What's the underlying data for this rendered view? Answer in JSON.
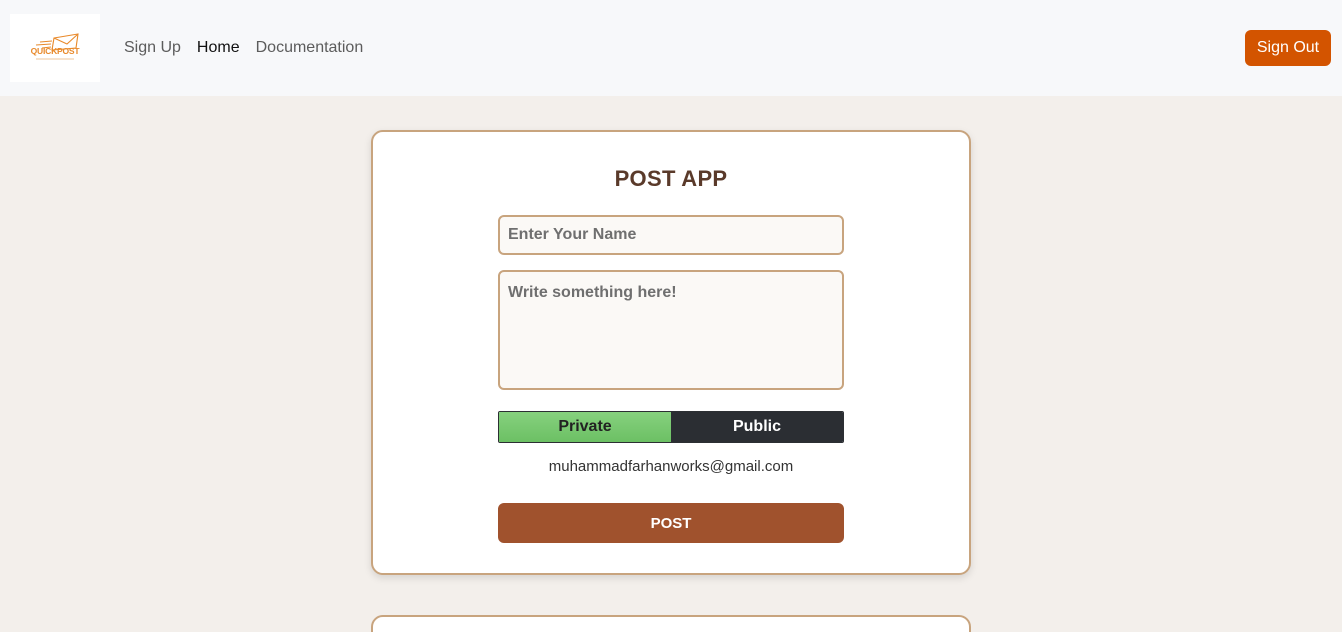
{
  "nav": {
    "logo_text": "QUICKPOST",
    "links": [
      {
        "label": "Sign Up"
      },
      {
        "label": "Home"
      },
      {
        "label": "Documentation"
      }
    ],
    "signout_label": "Sign Out"
  },
  "card": {
    "title": "POST APP",
    "name_placeholder": "Enter Your Name",
    "message_placeholder": "Write something here!",
    "visibility": {
      "private_label": "Private",
      "public_label": "Public"
    },
    "email": "muhammadfarhanworks@gmail.com",
    "post_label": "POST"
  },
  "colors": {
    "accent": "#d35400",
    "card_border": "#c8a47e",
    "post_button": "#a0522d",
    "toggle_private": "#7ccb73",
    "toggle_public": "#2b2e33"
  }
}
